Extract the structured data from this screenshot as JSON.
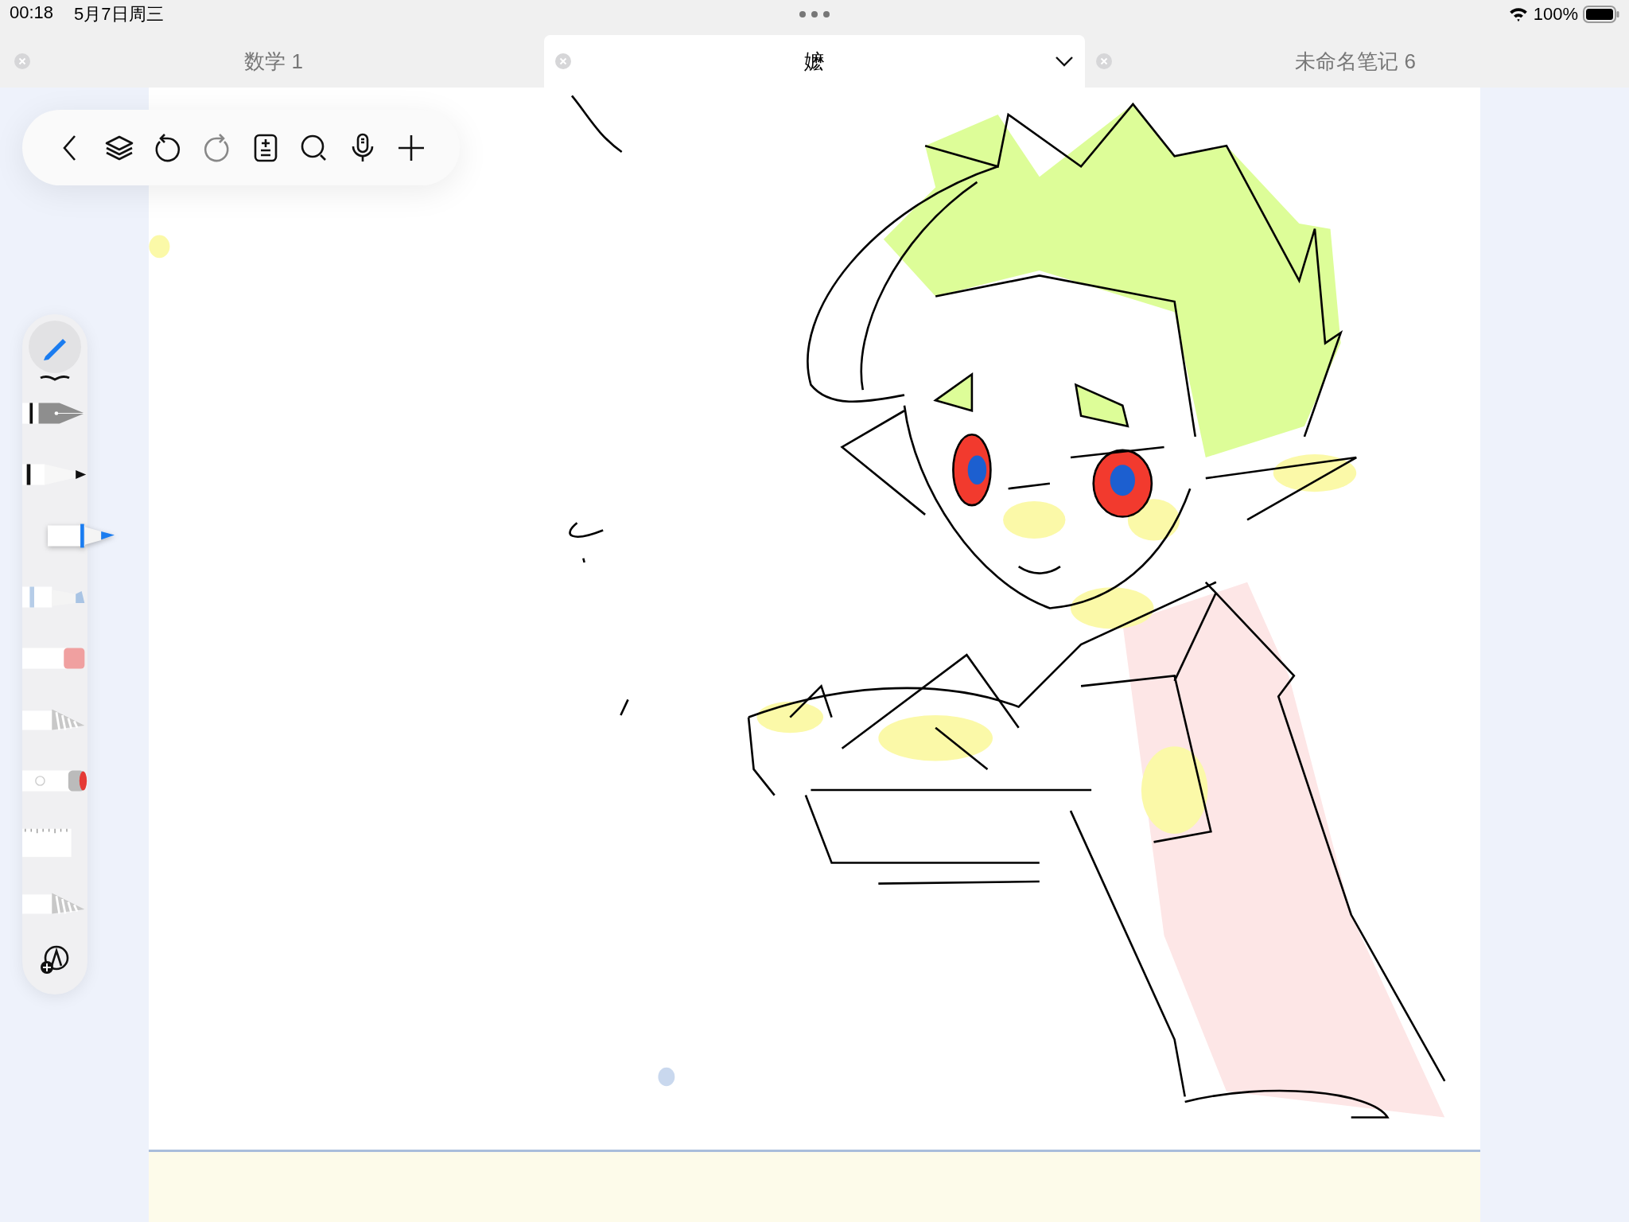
{
  "status_bar": {
    "time": "00:18",
    "date": "5月7日周三",
    "battery": "100%"
  },
  "tabs": [
    {
      "label": "数学 1",
      "selected": false
    },
    {
      "label": "嬷",
      "selected": true
    },
    {
      "label": "未命名笔记 6",
      "selected": false
    }
  ],
  "tools": [
    {
      "kind": "fountain-pen",
      "selected": false
    },
    {
      "kind": "ballpoint",
      "selected": false
    },
    {
      "kind": "marker",
      "selected": true
    },
    {
      "kind": "highlighter",
      "selected": false
    },
    {
      "kind": "eraser",
      "selected": false
    },
    {
      "kind": "lasso",
      "selected": false
    },
    {
      "kind": "laser",
      "selected": false
    },
    {
      "kind": "ruler",
      "selected": false
    },
    {
      "kind": "shape",
      "selected": false
    }
  ]
}
